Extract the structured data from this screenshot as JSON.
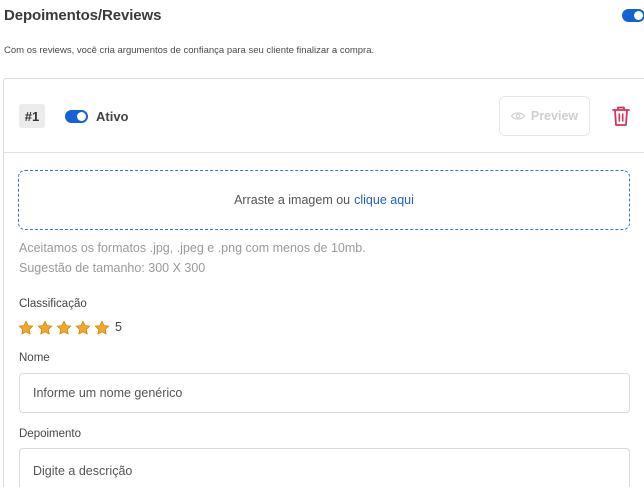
{
  "section": {
    "title": "Depoimentos/Reviews",
    "description": "Com os reviews, você cria argumentos de confiança para seu cliente finalizar a compra.",
    "enabled": true
  },
  "review": {
    "number_label": "#1",
    "active_label": "Ativo",
    "active": true,
    "preview_label": "Preview",
    "upload": {
      "prompt": "Arraste a imagem ou",
      "link": "clique aqui"
    },
    "formats_hint": "Aceitamos os formatos .jpg, .jpeg e .png com menos de 10mb.",
    "size_hint": "Sugestão de tamanho: 300 X 300",
    "rating_label": "Classificação",
    "rating_value": "5",
    "rating_max": 5,
    "name_label": "Nome",
    "name_placeholder": "Informe um nome genérico",
    "testimonial_label": "Depoimento",
    "testimonial_placeholder": "Digite a descrição"
  },
  "colors": {
    "accent": "#1561d6",
    "link": "#1f5fd0",
    "delete": "#d6315b",
    "star": "#f5a623"
  },
  "icons": [
    "toggle-icon",
    "eye-icon",
    "trash-icon",
    "star-icon"
  ]
}
